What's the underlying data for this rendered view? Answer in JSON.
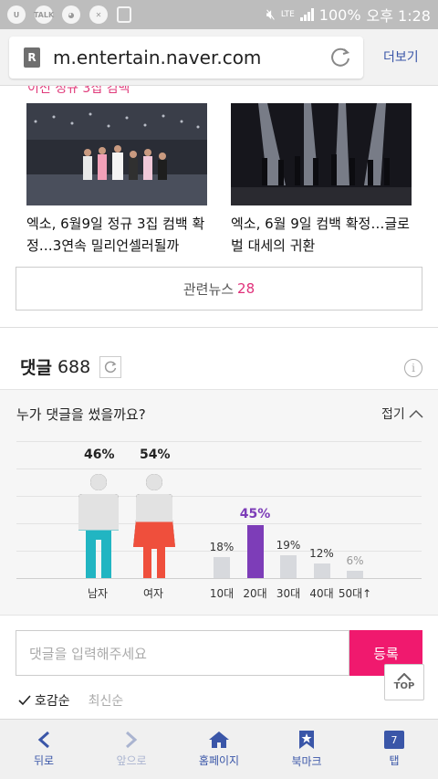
{
  "status_bar": {
    "battery": "100%",
    "time": "오후 1:28",
    "network": "LTE",
    "kakao_label": "TALK"
  },
  "browser": {
    "url": "m.entertain.naver.com",
    "more_label": "더보기"
  },
  "news": {
    "partial_header": "이전 정규 3집 컴백",
    "items": [
      {
        "title": "엑소, 6월9일 정규 3집 컴백 확정…3연속 밀리언셀러될까"
      },
      {
        "title": "엑소, 6월 9일 컴백 확정…글로벌 대세의 귀환"
      }
    ],
    "related_label": "관련뉴스",
    "related_count": "28"
  },
  "comments": {
    "label": "댓글",
    "count": "688",
    "stats_question": "누가 댓글을 썼을까요?",
    "fold_label": "접기",
    "gender": {
      "male": {
        "label": "남자",
        "pct": "46%",
        "value": 46,
        "color": "#21b5c2"
      },
      "female": {
        "label": "여자",
        "pct": "54%",
        "value": 54,
        "color": "#ef4f3c"
      }
    },
    "ages": [
      {
        "label": "10대",
        "pct": "18%",
        "value": 18
      },
      {
        "label": "20대",
        "pct": "45%",
        "value": 45,
        "highlight": true
      },
      {
        "label": "30대",
        "pct": "19%",
        "value": 19
      },
      {
        "label": "40대",
        "pct": "12%",
        "value": 12
      },
      {
        "label": "50대↑",
        "pct": "6%",
        "value": 6
      }
    ],
    "input_placeholder": "댓글을 입력해주세요",
    "submit_label": "등록",
    "top_label": "TOP",
    "sort": {
      "active": "호감순",
      "inactive": "최신순"
    }
  },
  "bottom_nav": {
    "back": "뒤로",
    "forward": "앞으로",
    "home": "홈페이지",
    "bookmark": "북마크",
    "tabs": "탭",
    "tab_count": "7"
  },
  "colors": {
    "accent": "#f0196e",
    "nav": "#3a56a8",
    "highlight_bar": "#7d3db8",
    "bar": "#d7d9dd"
  }
}
